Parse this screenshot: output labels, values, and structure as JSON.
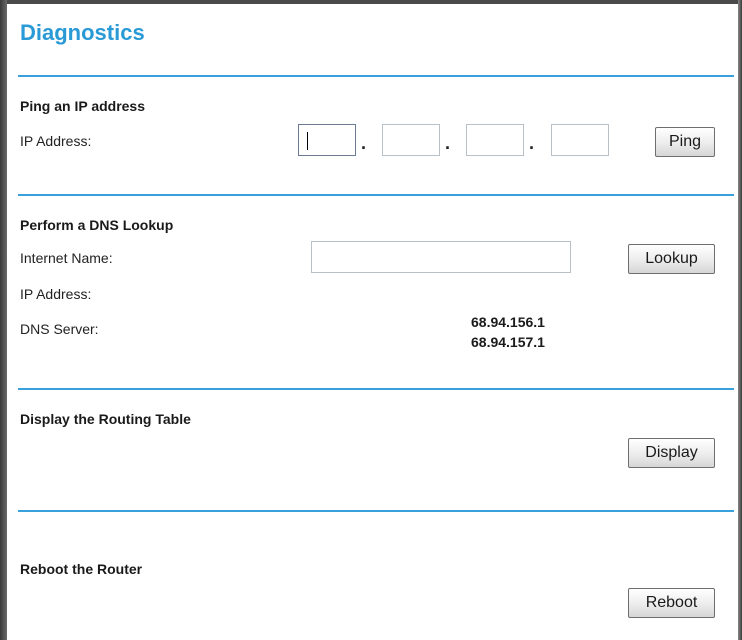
{
  "title": "Diagnostics",
  "ping": {
    "heading": "Ping an IP address",
    "ip_label": "IP Address:",
    "octets": [
      "",
      "",
      "",
      ""
    ],
    "separator": ".",
    "button": "Ping"
  },
  "dns": {
    "heading": "Perform a DNS Lookup",
    "name_label": "Internet Name:",
    "name_value": "",
    "button": "Lookup",
    "ip_label": "IP Address:",
    "server_label": "DNS Server:",
    "servers": [
      "68.94.156.1",
      "68.94.157.1"
    ]
  },
  "routing": {
    "heading": "Display the Routing Table",
    "button": "Display"
  },
  "reboot": {
    "heading": "Reboot the Router",
    "button": "Reboot"
  },
  "colors": {
    "accent": "#2a9ad6",
    "rule": "#3aa0dc"
  }
}
